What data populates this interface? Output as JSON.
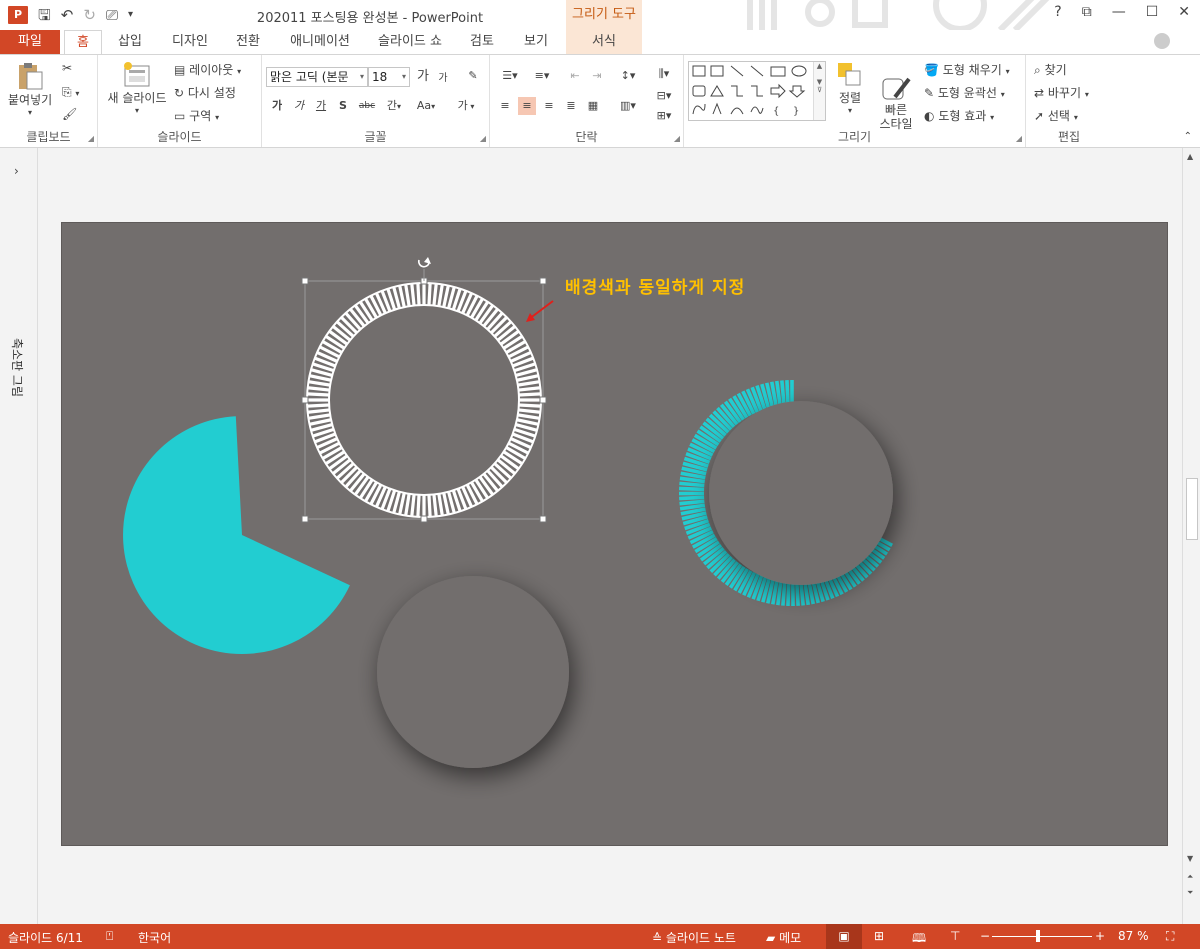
{
  "window": {
    "title": "202011 포스팅용 완성본 - PowerPoint",
    "app_icon": "P",
    "controls": [
      "?",
      "⧉",
      "—",
      "☐",
      "✕"
    ]
  },
  "contextual_tab_header": "그리기 도구",
  "tabs": {
    "file": "파일",
    "items": [
      "홈",
      "삽입",
      "디자인",
      "전환",
      "애니메이션",
      "슬라이드 쇼",
      "검토",
      "보기",
      "서식"
    ],
    "active": "홈"
  },
  "ribbon": {
    "clipboard": {
      "label": "클립보드",
      "paste": "붙여넣기"
    },
    "slides": {
      "label": "슬라이드",
      "new_slide": "새 슬라이드",
      "layout": "레이아웃",
      "reset": "다시 설정",
      "section": "구역"
    },
    "font": {
      "label": "글꼴",
      "font_name": "맑은 고딕 (본문",
      "font_size": "18",
      "grow": "가",
      "shrink": "가",
      "bold": "가",
      "italic": "가",
      "underline": "가",
      "shadow": "S",
      "strike": "abc",
      "spacing": "간",
      "case": "Aa",
      "color": "가"
    },
    "paragraph": {
      "label": "단락"
    },
    "drawing": {
      "label": "그리기",
      "arrange": "정렬",
      "quick_styles": "빠른\n스타일",
      "fill": "도형 채우기",
      "outline": "도형 윤곽선",
      "effects": "도형 효과"
    },
    "editing": {
      "label": "편집",
      "find": "찾기",
      "replace": "바꾸기",
      "select": "선택"
    }
  },
  "left_pane": {
    "label": "축소판 그림"
  },
  "slide": {
    "annotation": "배경색과 동일하게 지정",
    "background_color": "#726e6d",
    "accent_color": "#22cdd1",
    "annotation_color": "#ffc000",
    "arrow_color": "#e0201b"
  },
  "status": {
    "slide_counter": "슬라이드 6/11",
    "language": "한국어",
    "notes": "슬라이드 노트",
    "comments": "메모",
    "zoom": "87 %"
  }
}
